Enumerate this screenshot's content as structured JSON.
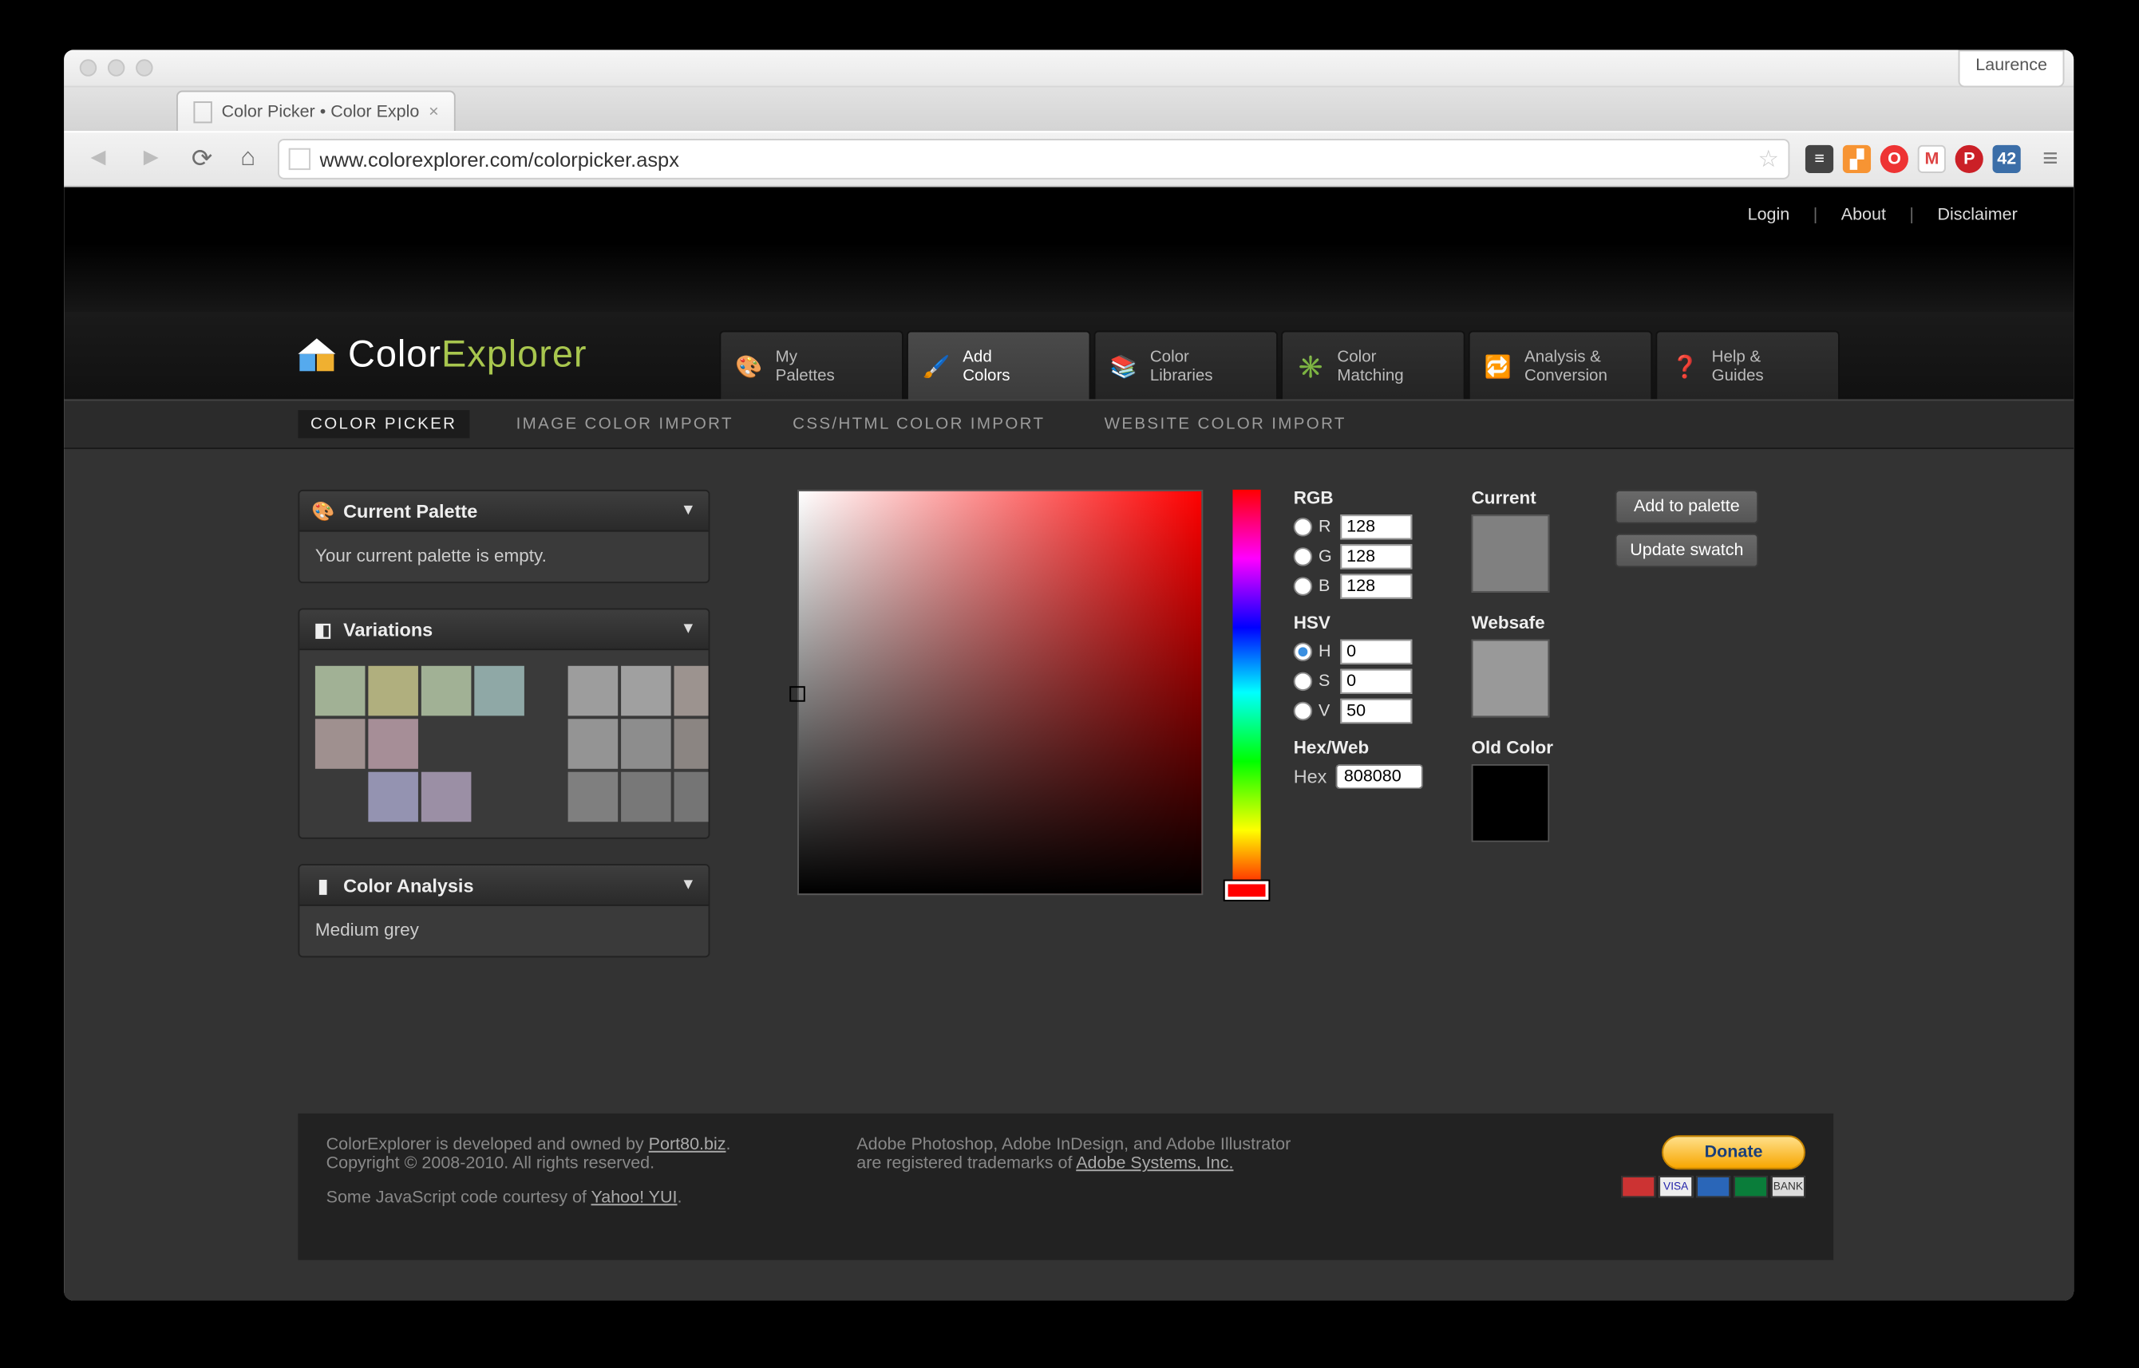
{
  "browser": {
    "user": "Laurence",
    "tab_title": "Color Picker • Color Explo",
    "url": "www.colorexplorer.com/colorpicker.aspx"
  },
  "header": {
    "top_links": [
      "Login",
      "About",
      "Disclaimer"
    ],
    "logo_prefix": "Color",
    "logo_suffix": "Explorer",
    "nav": [
      {
        "label_l1": "My",
        "label_l2": "Palettes",
        "icon": "🎨"
      },
      {
        "label_l1": "Add",
        "label_l2": "Colors",
        "icon": "🖌️",
        "active": true
      },
      {
        "label_l1": "Color",
        "label_l2": "Libraries",
        "icon": "📚"
      },
      {
        "label_l1": "Color",
        "label_l2": "Matching",
        "icon": "✳️"
      },
      {
        "label_l1": "Analysis &",
        "label_l2": "Conversion",
        "icon": "🔁"
      },
      {
        "label_l1": "Help &",
        "label_l2": "Guides",
        "icon": "❓"
      }
    ],
    "sub_nav": [
      {
        "label": "COLOR PICKER",
        "active": true
      },
      {
        "label": "IMAGE COLOR IMPORT"
      },
      {
        "label": "CSS/HTML COLOR IMPORT"
      },
      {
        "label": "WEBSITE COLOR IMPORT"
      }
    ]
  },
  "panels": {
    "palette": {
      "title": "Current Palette",
      "body": "Your current palette is empty."
    },
    "variations": {
      "title": "Variations",
      "left": [
        "#a1b195",
        "#b0af7e",
        "#a1b195",
        "#8fa8a6",
        "#9f908f",
        "#a68e97",
        "#9493b1",
        "#9b8fa5"
      ],
      "right": [
        "#9d9d9d",
        "#a0a0a0",
        "#9c938f",
        "#949494",
        "#8d8d8d",
        "#8b8582",
        "#7f7f7f",
        "#787878",
        "#757575"
      ]
    },
    "analysis": {
      "title": "Color Analysis",
      "body": "Medium grey"
    }
  },
  "picker": {
    "rgb_label": "RGB",
    "r": "128",
    "g": "128",
    "b": "128",
    "hsv_label": "HSV",
    "h": "0",
    "s": "0",
    "v": "50",
    "hex_label": "Hex/Web",
    "hex_lab": "Hex",
    "hex": "808080",
    "current_label": "Current",
    "current": "#808080",
    "websafe_label": "Websafe",
    "websafe": "#999999",
    "old_label": "Old Color",
    "old": "#000000"
  },
  "buttons": {
    "add": "Add to palette",
    "update": "Update swatch"
  },
  "footer": {
    "l1": "ColorExplorer is developed and owned by ",
    "l1_link": "Port80.biz",
    "l2": "Copyright © 2008-2010. All rights reserved.",
    "l3": "Some JavaScript code courtesy of ",
    "l3_link": "Yahoo! YUI",
    "m1": "Adobe Photoshop, Adobe InDesign, and Adobe Illustrator",
    "m2": "are registered trademarks of ",
    "m2_link": "Adobe Systems, Inc.",
    "donate": "Donate"
  }
}
